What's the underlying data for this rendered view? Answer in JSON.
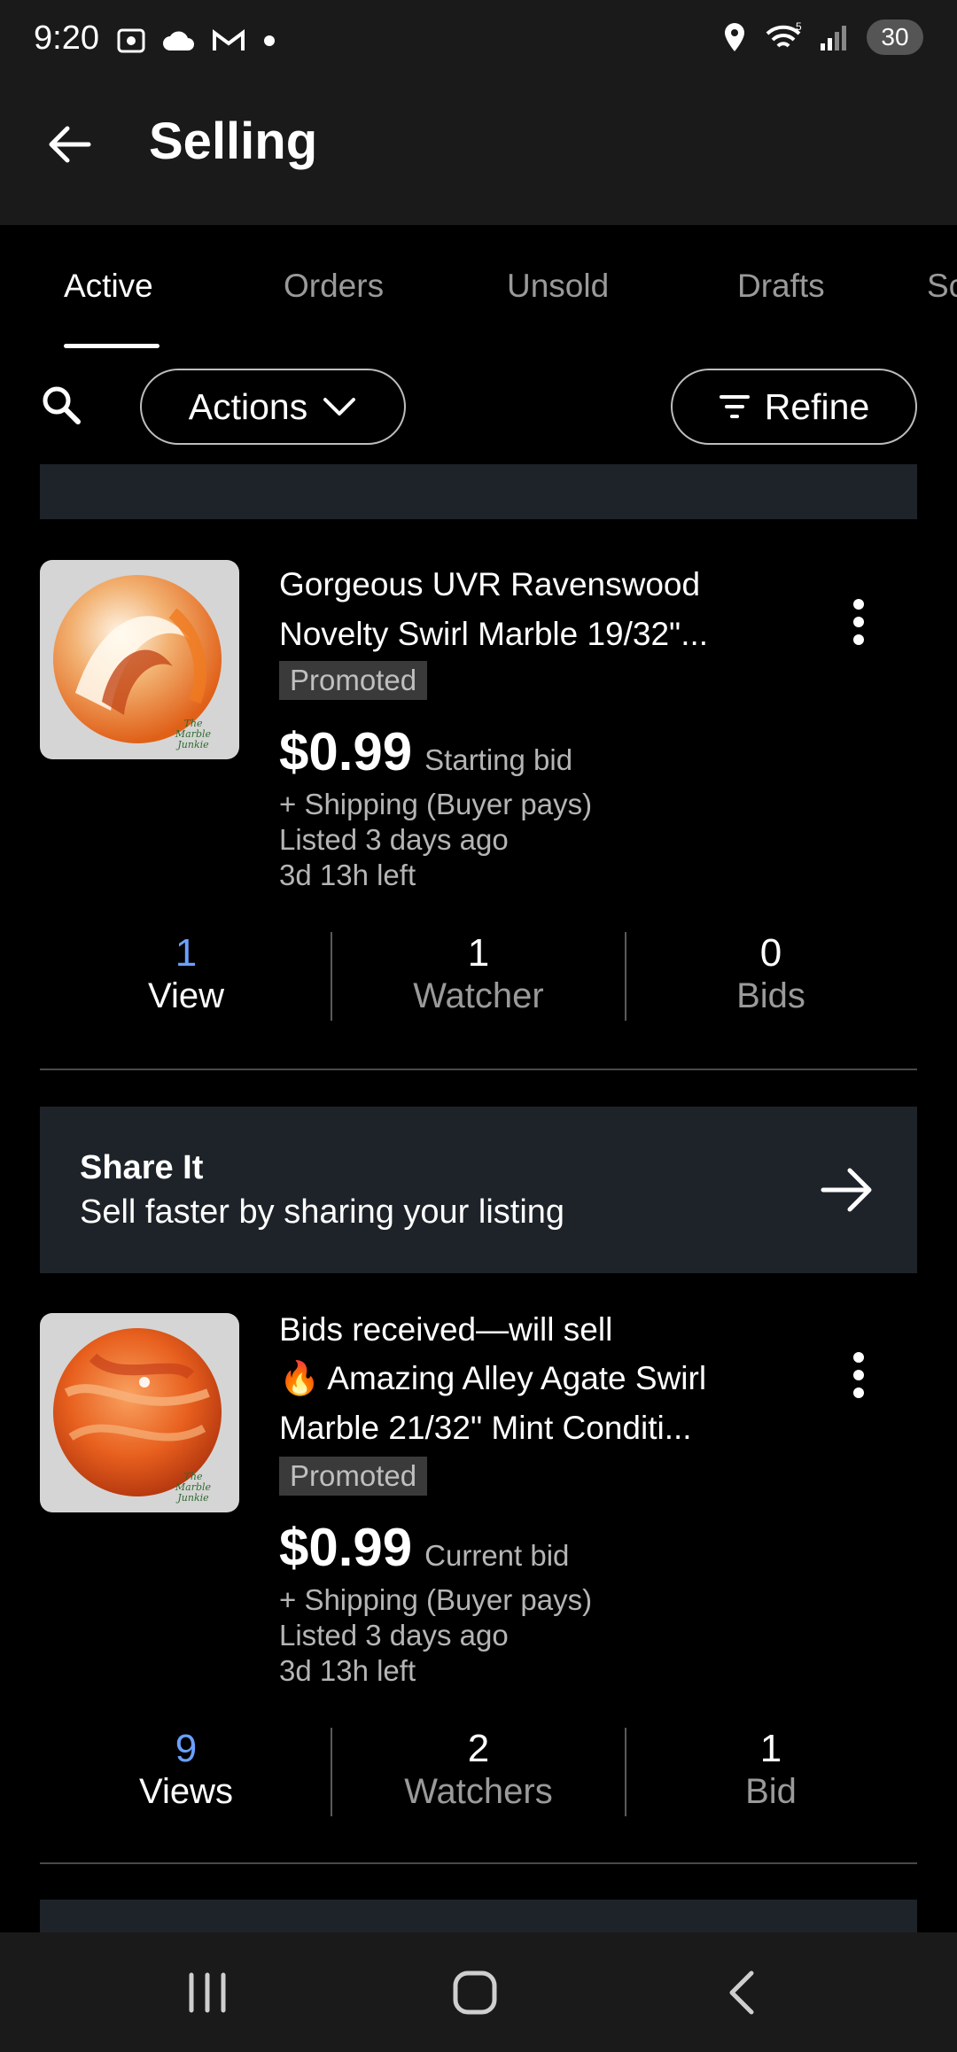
{
  "status_bar": {
    "time": "9:20",
    "battery": "30"
  },
  "header": {
    "title": "Selling"
  },
  "tabs": [
    {
      "label": "Active",
      "active": true
    },
    {
      "label": "Orders",
      "active": false
    },
    {
      "label": "Unsold",
      "active": false
    },
    {
      "label": "Drafts",
      "active": false
    },
    {
      "label": "Sc",
      "active": false
    }
  ],
  "filters": {
    "actions_label": "Actions",
    "refine_label": "Refine"
  },
  "listings": [
    {
      "status_line": "",
      "title": "Gorgeous UVR Ravenswood Novelty Swirl Marble 19/32\"...",
      "badge": "Promoted",
      "price": "$0.99",
      "price_label": "Starting bid",
      "shipping": "+ Shipping (Buyer pays)",
      "listed": "Listed 3 days ago",
      "time_left": "3d 13h left",
      "thumb_brand": "The Marble Junkie",
      "stats": [
        {
          "value": "1",
          "label": "View"
        },
        {
          "value": "1",
          "label": "Watcher"
        },
        {
          "value": "0",
          "label": "Bids"
        }
      ]
    },
    {
      "status_line": "Bids received—will sell",
      "title": "🔥 Amazing Alley Agate Swirl Marble 21/32\" Mint Conditi...",
      "badge": "Promoted",
      "price": "$0.99",
      "price_label": "Current bid",
      "shipping": "+ Shipping (Buyer pays)",
      "listed": "Listed 3 days ago",
      "time_left": "3d 13h left",
      "thumb_brand": "The Marble Junkie",
      "stats": [
        {
          "value": "9",
          "label": "Views"
        },
        {
          "value": "2",
          "label": "Watchers"
        },
        {
          "value": "1",
          "label": "Bid"
        }
      ]
    }
  ],
  "share": {
    "title": "Share It",
    "text": "Sell faster by sharing your listing"
  },
  "colors": {
    "accent_blue": "#6aa1ff",
    "card_bg": "#1e2329"
  }
}
